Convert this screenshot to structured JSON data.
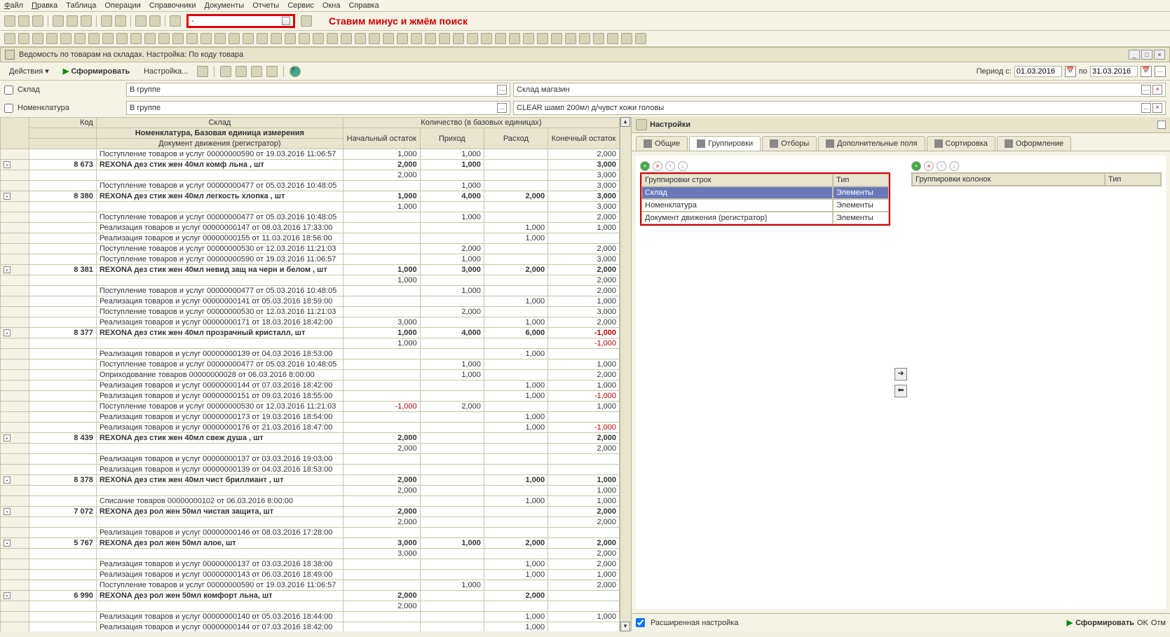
{
  "menu": [
    "Файл",
    "Правка",
    "Таблица",
    "Операции",
    "Справочники",
    "Документы",
    "Отчеты",
    "Сервис",
    "Окна",
    "Справка"
  ],
  "annotation": "Ставим минус и жмём поиск",
  "search_value": "-",
  "subwin_title": "Ведомость по товарам на складах. Настройка: По коду товара",
  "actionbar": {
    "actions": "Действия",
    "form": "Сформировать",
    "setup": "Настройка..."
  },
  "period": {
    "label": "Период с:",
    "from": "01.03.2016",
    "to_lbl": "по",
    "to": "31.03.2016"
  },
  "filters": {
    "sklad_lbl": "Склад",
    "sklad_op": "В группе",
    "sklad_val": "Склад магазин",
    "nom_lbl": "Номенклатура",
    "nom_op": "В группе",
    "nom_val": "CLEAR шамп 200мл д/чувст кожи головы"
  },
  "headers": {
    "kod": "Код",
    "sklad": "Склад",
    "qty": "Количество (в базовых единицах)",
    "nom": "Номенклатура, Базовая единица измерения",
    "doc": "Документ движения (регистратор)",
    "beg": "Начальный остаток",
    "in": "Приход",
    "out": "Расход",
    "end": "Конечный остаток"
  },
  "rows": [
    {
      "t": "l",
      "name": "Поступление товаров и услуг 00000000590 от 19.03.2016 11:06:57",
      "b": "1,000",
      "i": "1,000",
      "o": "",
      "e": "2,000"
    },
    {
      "t": "b",
      "code": "8 673",
      "name": "REXONA  дез стик жен 40мл комф льна , шт",
      "b": "2,000",
      "i": "1,000",
      "o": "",
      "e": "3,000"
    },
    {
      "t": "l",
      "name": "",
      "b": "2,000",
      "i": "",
      "o": "",
      "e": "3,000"
    },
    {
      "t": "l",
      "name": "Поступление товаров и услуг 00000000477 от 05.03.2016 10:48:05",
      "b": "",
      "i": "1,000",
      "o": "",
      "e": "3,000"
    },
    {
      "t": "b",
      "code": "8 380",
      "name": "REXONA  дез стик жен 40мл легкость хлопка , шт",
      "b": "1,000",
      "i": "4,000",
      "o": "2,000",
      "e": "3,000"
    },
    {
      "t": "l",
      "name": "",
      "b": "1,000",
      "i": "",
      "o": "",
      "e": "3,000"
    },
    {
      "t": "l",
      "name": "Поступление товаров и услуг 00000000477 от 05.03.2016 10:48:05",
      "b": "",
      "i": "1,000",
      "o": "",
      "e": "2,000"
    },
    {
      "t": "l",
      "name": "Реализация товаров и услуг 00000000147 от 08.03.2016 17:33:00",
      "b": "",
      "i": "",
      "o": "1,000",
      "e": "1,000"
    },
    {
      "t": "l",
      "name": "Реализация товаров и услуг 00000000155 от 11.03.2016 18:56:00",
      "b": "",
      "i": "",
      "o": "1,000",
      "e": ""
    },
    {
      "t": "l",
      "name": "Поступление товаров и услуг 00000000530 от 12.03.2016 11:21:03",
      "b": "",
      "i": "2,000",
      "o": "",
      "e": "2,000"
    },
    {
      "t": "l",
      "name": "Поступление товаров и услуг 00000000590 от 19.03.2016 11:06:57",
      "b": "",
      "i": "1,000",
      "o": "",
      "e": "3,000"
    },
    {
      "t": "b",
      "code": "8 381",
      "name": "REXONA  дез стик жен 40мл невид защ на черн и белом , шт",
      "b": "1,000",
      "i": "3,000",
      "o": "2,000",
      "e": "2,000"
    },
    {
      "t": "l",
      "name": "",
      "b": "1,000",
      "i": "",
      "o": "",
      "e": "2,000"
    },
    {
      "t": "l",
      "name": "Поступление товаров и услуг 00000000477 от 05.03.2016 10:48:05",
      "b": "",
      "i": "1,000",
      "o": "",
      "e": "2,000"
    },
    {
      "t": "l",
      "name": "Реализация товаров и услуг 00000000141 от 05.03.2016 18:59:00",
      "b": "",
      "i": "",
      "o": "1,000",
      "e": "1,000"
    },
    {
      "t": "l",
      "name": "Поступление товаров и услуг 00000000530 от 12.03.2016 11:21:03",
      "b": "",
      "i": "2,000",
      "o": "",
      "e": "3,000"
    },
    {
      "t": "l",
      "name": "Реализация товаров и услуг 00000000171 от 18.03.2016 18:42:00",
      "b": "3,000",
      "i": "",
      "o": "1,000",
      "e": "2,000"
    },
    {
      "t": "b",
      "code": "8 377",
      "name": "REXONA  дез стик жен 40мл прозрачный кристалл, шт",
      "b": "1,000",
      "i": "4,000",
      "o": "6,000",
      "e": "-1,000",
      "neg": true
    },
    {
      "t": "l",
      "name": "",
      "b": "1,000",
      "i": "",
      "o": "",
      "e": "-1,000",
      "neg": true
    },
    {
      "t": "l",
      "name": "Реализация товаров и услуг 00000000139 от 04.03.2016 18:53:00",
      "b": "",
      "i": "",
      "o": "1,000",
      "e": ""
    },
    {
      "t": "l",
      "name": "Поступление товаров и услуг 00000000477 от 05.03.2016 10:48:05",
      "b": "",
      "i": "1,000",
      "o": "",
      "e": "1,000"
    },
    {
      "t": "l",
      "name": "Оприходование товаров 00000000028 от 06.03.2016 8:00:00",
      "b": "",
      "i": "1,000",
      "o": "",
      "e": "2,000"
    },
    {
      "t": "l",
      "name": "Реализация товаров и услуг 00000000144 от 07.03.2016 18:42:00",
      "b": "",
      "i": "",
      "o": "1,000",
      "e": "1,000"
    },
    {
      "t": "l",
      "name": "Реализация товаров и услуг 00000000151 от 09.03.2016 18:55:00",
      "b": "",
      "i": "",
      "o": "1,000",
      "e": "-1,000",
      "neg": true
    },
    {
      "t": "l",
      "name": "Поступление товаров и услуг 00000000530 от 12.03.2016 11:21:03",
      "b": "-1,000",
      "i": "2,000",
      "o": "",
      "e": "1,000",
      "negb": true
    },
    {
      "t": "l",
      "name": "Реализация товаров и услуг 00000000173 от 19.03.2016 18:54:00",
      "b": "",
      "i": "",
      "o": "1,000",
      "e": ""
    },
    {
      "t": "l",
      "name": "Реализация товаров и услуг 00000000176 от 21.03.2016 18:47:00",
      "b": "",
      "i": "",
      "o": "1,000",
      "e": "-1,000",
      "neg": true
    },
    {
      "t": "b",
      "code": "8 439",
      "name": "REXONA  дез стик жен 40мл свеж  душа , шт",
      "b": "2,000",
      "i": "",
      "o": "",
      "e": "2,000"
    },
    {
      "t": "l",
      "name": "",
      "b": "2,000",
      "i": "",
      "o": "",
      "e": "2,000"
    },
    {
      "t": "l",
      "name": "Реализация товаров и услуг 00000000137 от 03.03.2016 19:03:00",
      "b": "",
      "i": "",
      "o": "",
      "e": ""
    },
    {
      "t": "l",
      "name": "Реализация товаров и услуг 00000000139 от 04.03.2016 18:53:00",
      "b": "",
      "i": "",
      "o": "",
      "e": ""
    },
    {
      "t": "b",
      "code": "8 378",
      "name": "REXONA  дез стик жен 40мл чист бриллиант , шт",
      "b": "2,000",
      "i": "",
      "o": "1,000",
      "e": "1,000"
    },
    {
      "t": "l",
      "name": "",
      "b": "2,000",
      "i": "",
      "o": "",
      "e": "1,000"
    },
    {
      "t": "l",
      "name": "Списание товаров 00000000102 от 06.03.2016 8:00:00",
      "b": "",
      "i": "",
      "o": "1,000",
      "e": "1,000"
    },
    {
      "t": "b",
      "code": "7 072",
      "name": "REXONA дез рол жен  50мл чистая защита, шт",
      "b": "2,000",
      "i": "",
      "o": "",
      "e": "2,000"
    },
    {
      "t": "l",
      "name": "",
      "b": "2,000",
      "i": "",
      "o": "",
      "e": "2,000"
    },
    {
      "t": "l",
      "name": "Реализация товаров и услуг 00000000146 от 08.03.2016 17:28:00",
      "b": "",
      "i": "",
      "o": "",
      "e": ""
    },
    {
      "t": "b",
      "code": "5 767",
      "name": "REXONA дез рол жен 50мл алое, шт",
      "b": "3,000",
      "i": "1,000",
      "o": "2,000",
      "e": "2,000"
    },
    {
      "t": "l",
      "name": "",
      "b": "3,000",
      "i": "",
      "o": "",
      "e": "2,000"
    },
    {
      "t": "l",
      "name": "Реализация товаров и услуг 00000000137 от 03.03.2016 18:38:00",
      "b": "",
      "i": "",
      "o": "1,000",
      "e": "2,000"
    },
    {
      "t": "l",
      "name": "Реализация товаров и услуг 00000000143 от 06.03.2016 18:49:00",
      "b": "",
      "i": "",
      "o": "1,000",
      "e": "1,000"
    },
    {
      "t": "l",
      "name": "Поступление товаров и услуг 00000000590 от 19.03.2016 11:06:57",
      "b": "",
      "i": "1,000",
      "o": "",
      "e": "2,000"
    },
    {
      "t": "b",
      "code": "6 990",
      "name": "REXONA дез рол жен 50мл комфорт льна, шт",
      "b": "2,000",
      "i": "",
      "o": "2,000",
      "e": ""
    },
    {
      "t": "l",
      "name": "",
      "b": "2,000",
      "i": "",
      "o": "",
      "e": ""
    },
    {
      "t": "l",
      "name": "Реализация товаров и услуг 00000000140 от 05.03.2016 18:44:00",
      "b": "",
      "i": "",
      "o": "1,000",
      "e": "1,000"
    },
    {
      "t": "l",
      "name": "Реализация товаров и услуг 00000000144 от 07.03.2016 18:42:00",
      "b": "",
      "i": "",
      "o": "1,000",
      "e": ""
    }
  ],
  "settings": {
    "title": "Настройки",
    "tabs": [
      "Общие",
      "Группировки",
      "Отборы",
      "Дополнительные поля",
      "Сортировка",
      "Оформление"
    ],
    "active_tab": 1,
    "left_hdr1": "Группировки строк",
    "left_hdr2": "Тип",
    "right_hdr1": "Группировки колонок",
    "right_hdr2": "Тип",
    "rows": [
      {
        "n": "Склад",
        "t": "Элементы",
        "sel": true
      },
      {
        "n": "Номенклатура",
        "t": "Элементы"
      },
      {
        "n": "Документ движения (регистратор)",
        "t": "Элементы"
      }
    ],
    "ext": "Расширенная настройка",
    "form": "Сформировать",
    "ok": "OK",
    "cancel": "Отм"
  }
}
